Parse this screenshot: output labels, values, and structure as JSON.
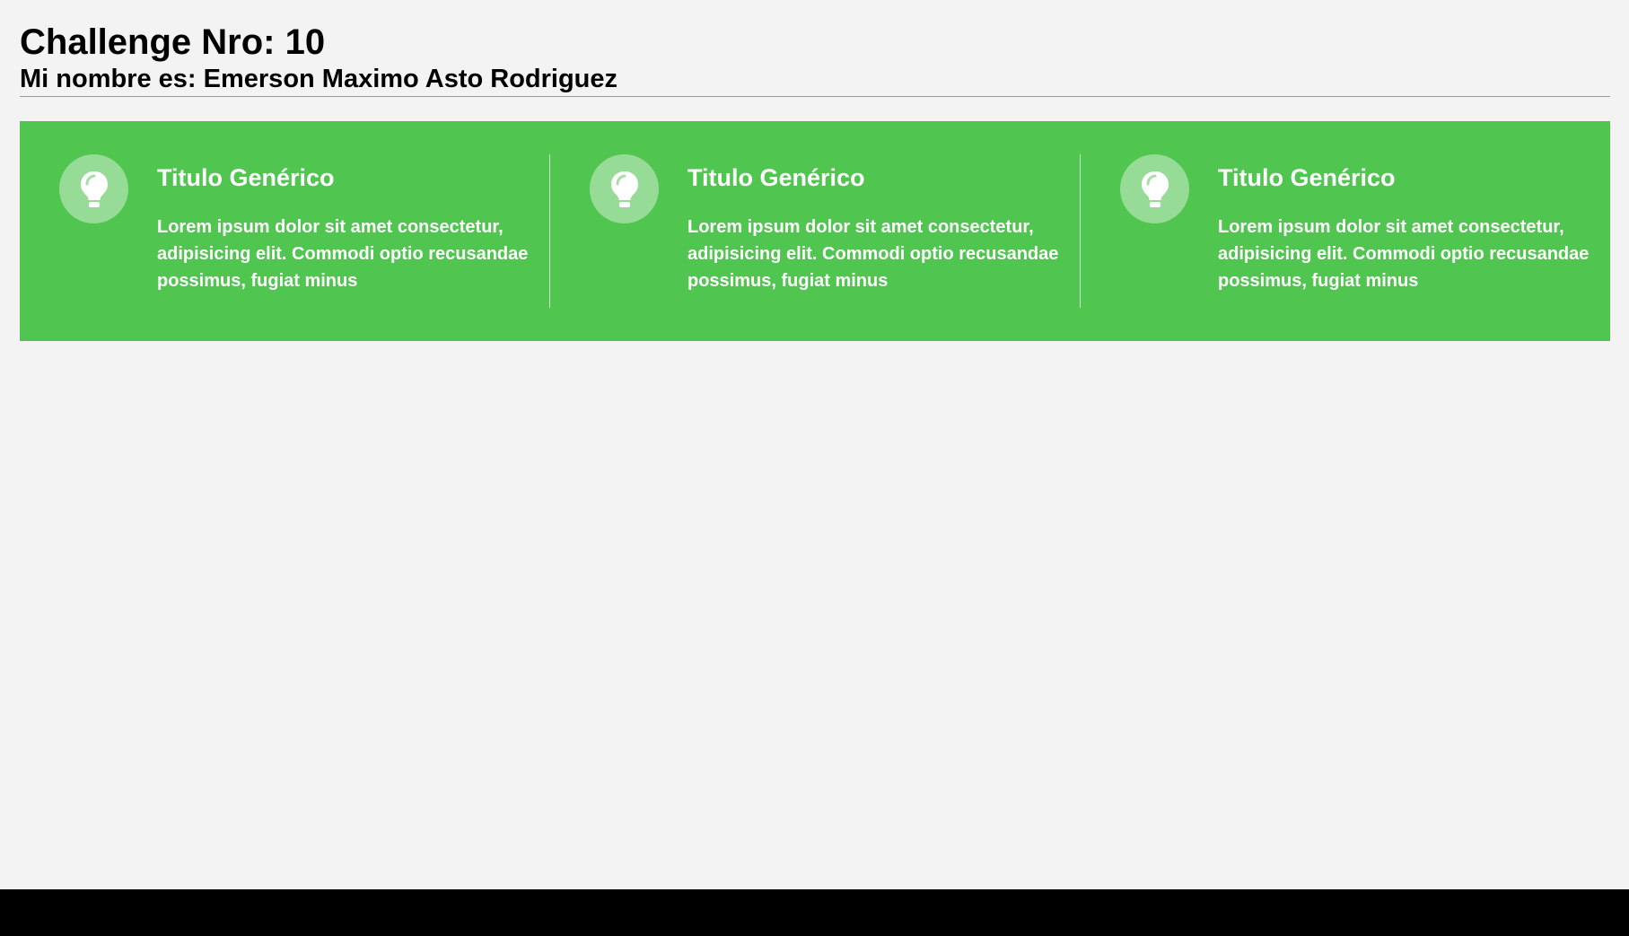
{
  "header": {
    "title": "Challenge Nro: 10",
    "subtitle": "Mi nombre es: Emerson Maximo Asto Rodriguez"
  },
  "colors": {
    "background": "#f3f3f3",
    "banner": "#50c550",
    "text_on_banner": "#ffffff"
  },
  "cards": [
    {
      "icon": "lightbulb-icon",
      "title": "Titulo Genérico",
      "text": "Lorem ipsum dolor sit amet consectetur, adipisicing elit. Commodi optio recusandae possimus, fugiat minus"
    },
    {
      "icon": "lightbulb-icon",
      "title": "Titulo Genérico",
      "text": "Lorem ipsum dolor sit amet consectetur, adipisicing elit. Commodi optio recusandae possimus, fugiat minus"
    },
    {
      "icon": "lightbulb-icon",
      "title": "Titulo Genérico",
      "text": "Lorem ipsum dolor sit amet consectetur, adipisicing elit. Commodi optio recusandae possimus, fugiat minus"
    }
  ]
}
